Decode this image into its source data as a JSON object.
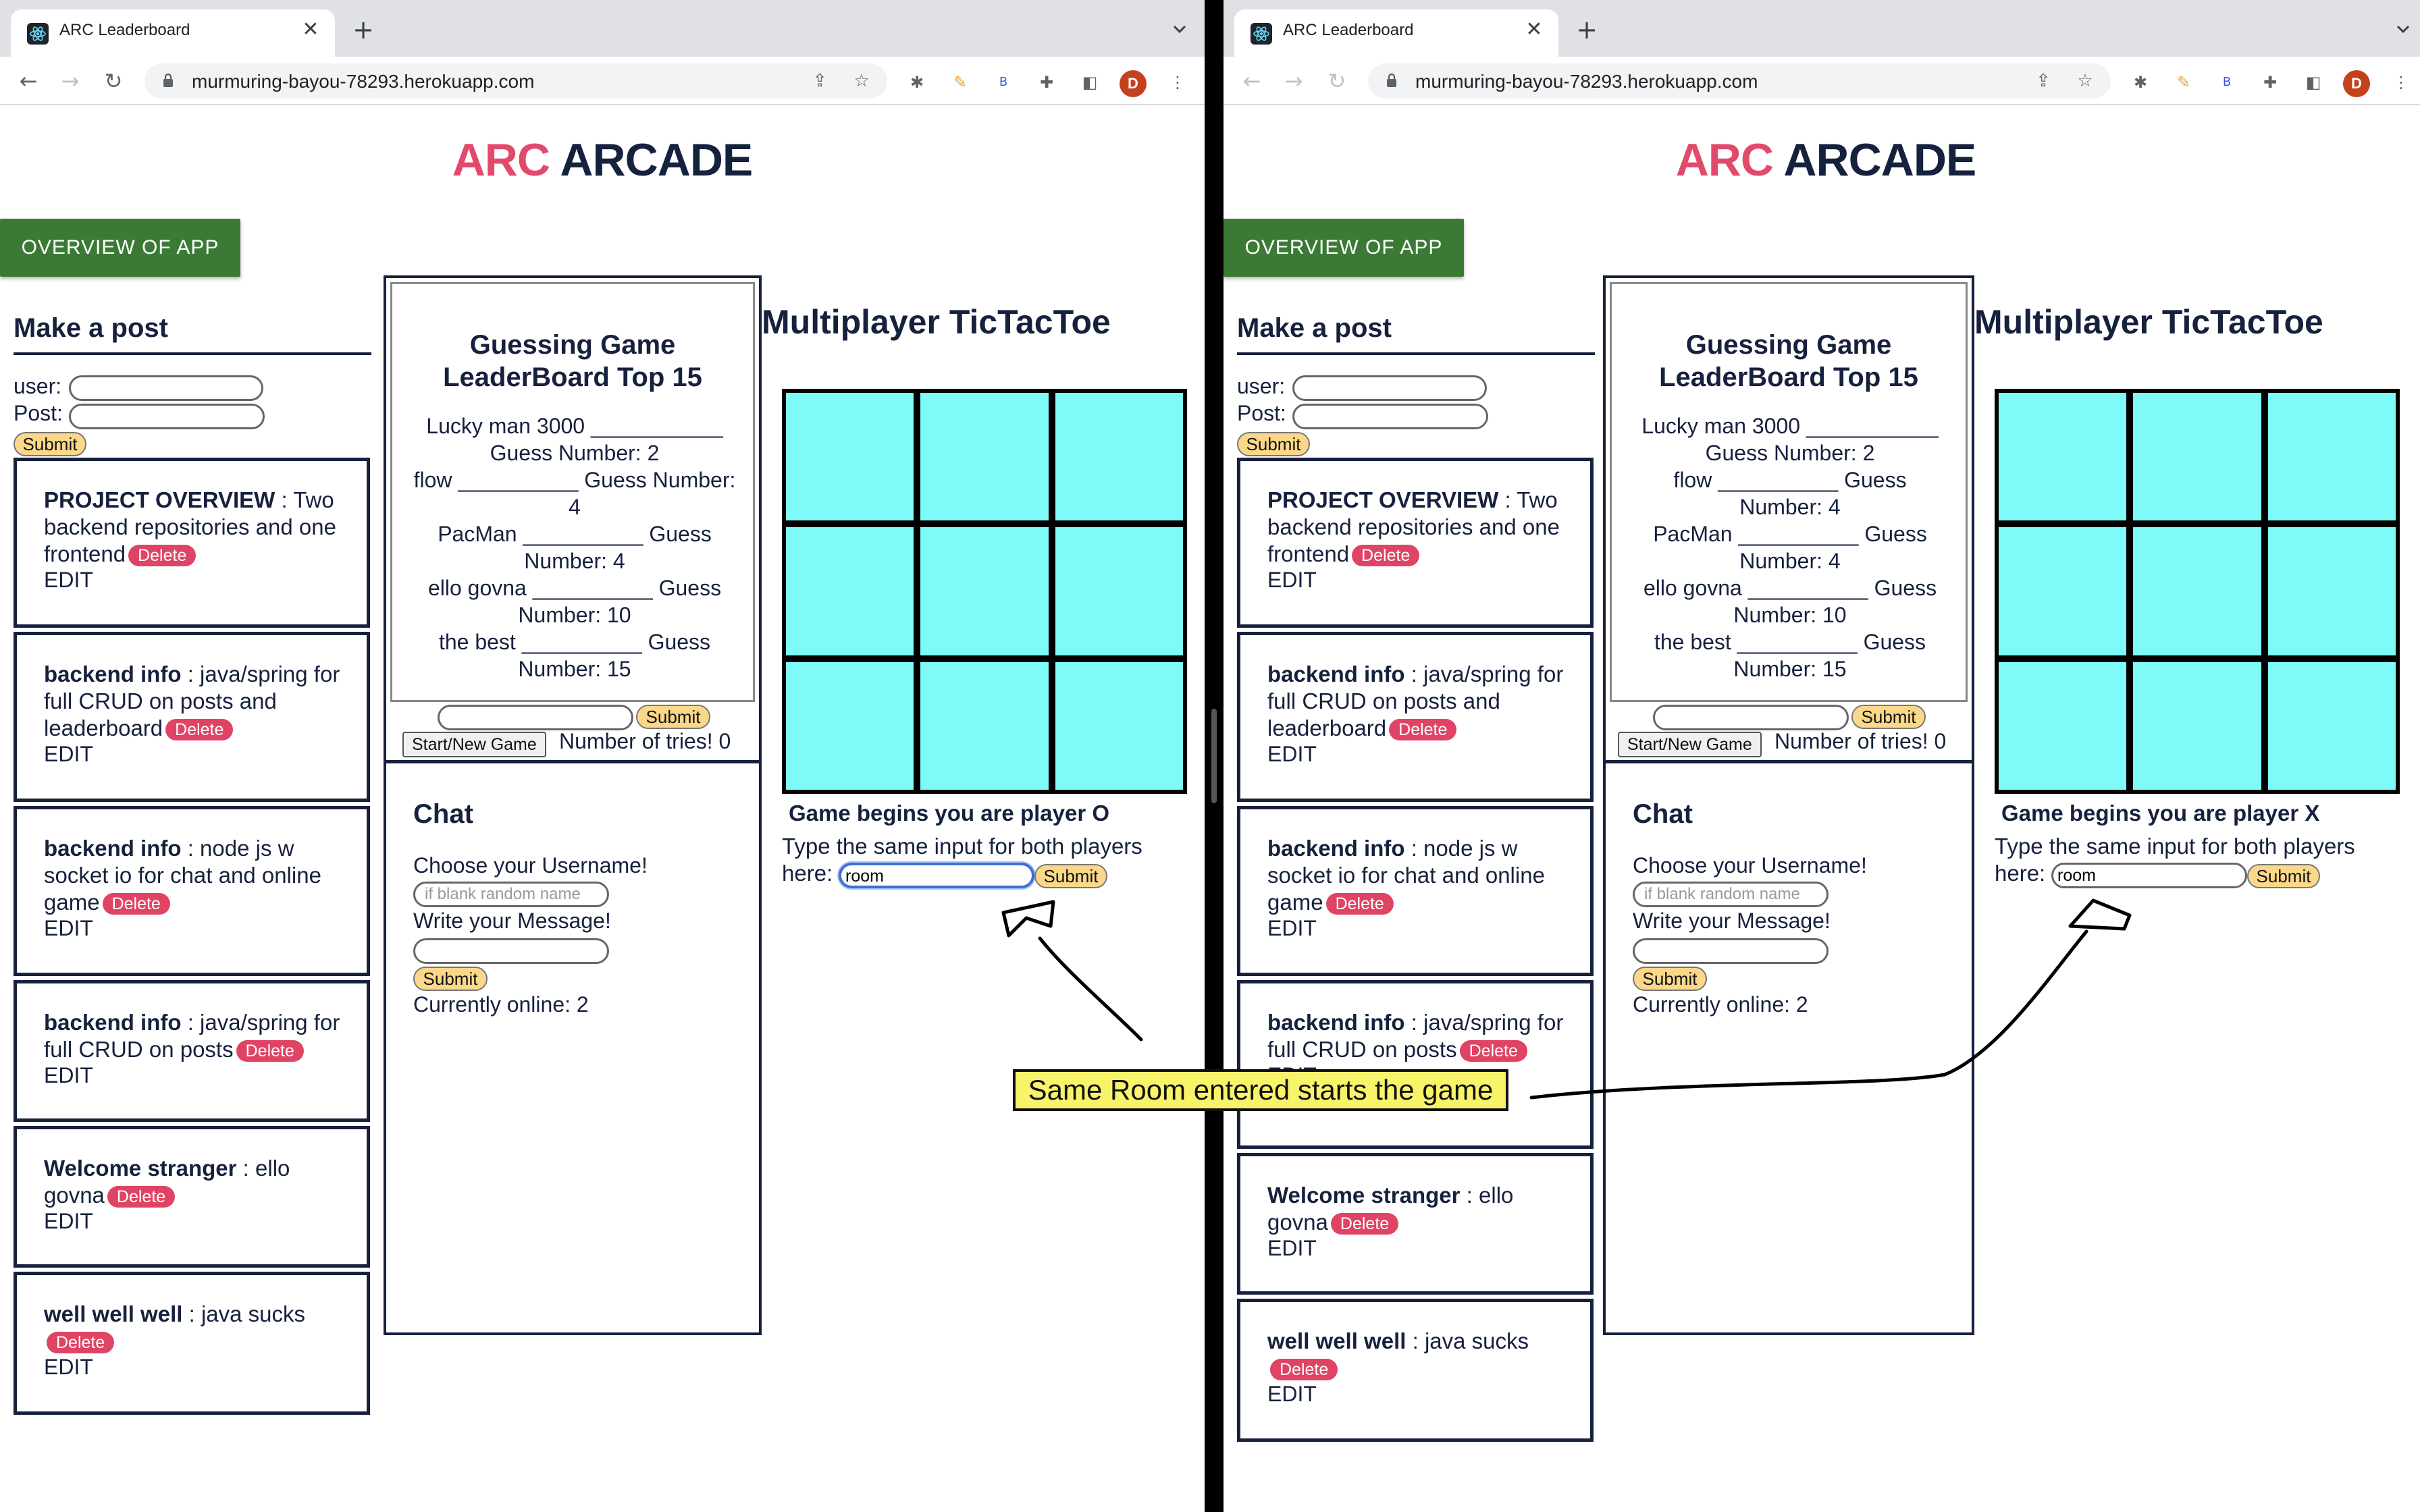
{
  "browser": {
    "tab_title": "ARC Leaderboard",
    "tab_close": "✕",
    "new_tab": "+",
    "url": "murmuring-bayou-78293.herokuapp.com",
    "avatar_letter": "D",
    "ext_b": "B"
  },
  "site": {
    "title_arc": "ARC",
    "title_arcade": "ARCADE",
    "overview_button": "OVERVIEW OF APP"
  },
  "make_post": {
    "heading": "Make a post",
    "user_label": "user:",
    "post_label": "Post:",
    "submit": "Submit"
  },
  "posts": [
    {
      "title": "PROJECT OVERVIEW",
      "separator": " : ",
      "body": "Two backend repositories and one frontend"
    },
    {
      "title": "backend info",
      "separator": " : ",
      "body": "java/spring for full CRUD on posts and leaderboard"
    },
    {
      "title": "backend info",
      "separator": " : ",
      "body": "node js w socket io for chat and online game"
    },
    {
      "title": "backend info",
      "separator": " : ",
      "body": "java/spring for full CRUD on posts"
    },
    {
      "title": "Welcome stranger",
      "separator": " : ",
      "body": "ello govna"
    },
    {
      "title": "well well well",
      "separator": " : ",
      "body": "java sucks"
    }
  ],
  "post_actions": {
    "delete": "Delete",
    "edit": "EDIT"
  },
  "leaderboard": {
    "title_line1": "Guessing Game",
    "title_line2": "LeaderBoard Top 15",
    "entries": [
      {
        "name": "Lucky man 3000",
        "blank": "___________",
        "label": "Guess Number:",
        "value": "2"
      },
      {
        "name": "flow",
        "blank": "__________",
        "label": "Guess Number:",
        "value": "4"
      },
      {
        "name": "PacMan",
        "blank": "__________",
        "label": "Guess Number:",
        "value": "4"
      },
      {
        "name": "ello govna",
        "blank": "__________",
        "label": "Guess Number:",
        "value": "10"
      },
      {
        "name": "the best",
        "blank": "__________",
        "label": "Guess Number:",
        "value": "15"
      }
    ],
    "submit": "Submit",
    "start_new": "Start/New Game",
    "tries_text": "Number of tries! 0"
  },
  "chat": {
    "heading": "Chat",
    "username_label": "Choose your Username!",
    "username_placeholder": "if blank random name",
    "message_label": "Write your Message!",
    "submit": "Submit",
    "online_text": "Currently online: 2"
  },
  "tictactoe": {
    "heading": "Multiplayer TicTacToe",
    "status_left": "Game begins you are player O",
    "status_right": "Game begins you are player X",
    "instruction": "Type the same input for both players here:",
    "room_value": "room",
    "submit": "Submit"
  },
  "annotation": {
    "callout": "Same Room entered starts the game"
  }
}
